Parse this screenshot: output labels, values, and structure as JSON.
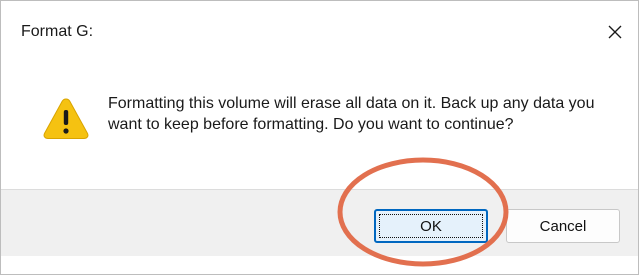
{
  "dialog": {
    "title": "Format G:",
    "message": "Formatting this volume will erase all data on it. Back up any data you want to keep before formatting. Do you want to continue?",
    "close_icon": "close-icon",
    "warning_icon": "warning-icon",
    "buttons": {
      "ok_label": "OK",
      "cancel_label": "Cancel"
    }
  },
  "annotation": {
    "shape": "circle",
    "color": "#e2704f",
    "target": "ok-button"
  },
  "colors": {
    "accent": "#0067c0",
    "warning_fill": "#f5c211",
    "footer_bg": "#f0f0f0"
  }
}
